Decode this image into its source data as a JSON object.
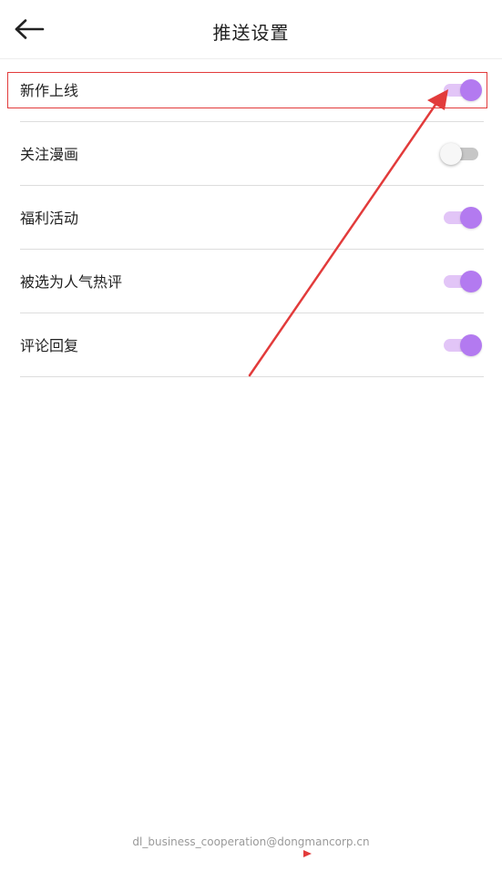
{
  "header": {
    "title": "推送设置",
    "back_icon": "arrow-left-icon"
  },
  "settings": [
    {
      "label": "新作上线",
      "enabled": true
    },
    {
      "label": "关注漫画",
      "enabled": false
    },
    {
      "label": "福利活动",
      "enabled": true
    },
    {
      "label": "被选为人气热评",
      "enabled": true
    },
    {
      "label": "评论回复",
      "enabled": true
    }
  ],
  "footer": {
    "email": "dl_business_cooperation@dongmancorp.cn"
  },
  "colors": {
    "toggle_on_knob": "#b37af0",
    "toggle_on_track": "#e2c5f7",
    "toggle_off_track": "#c6c6c6",
    "annotation": "#e23b3b"
  }
}
